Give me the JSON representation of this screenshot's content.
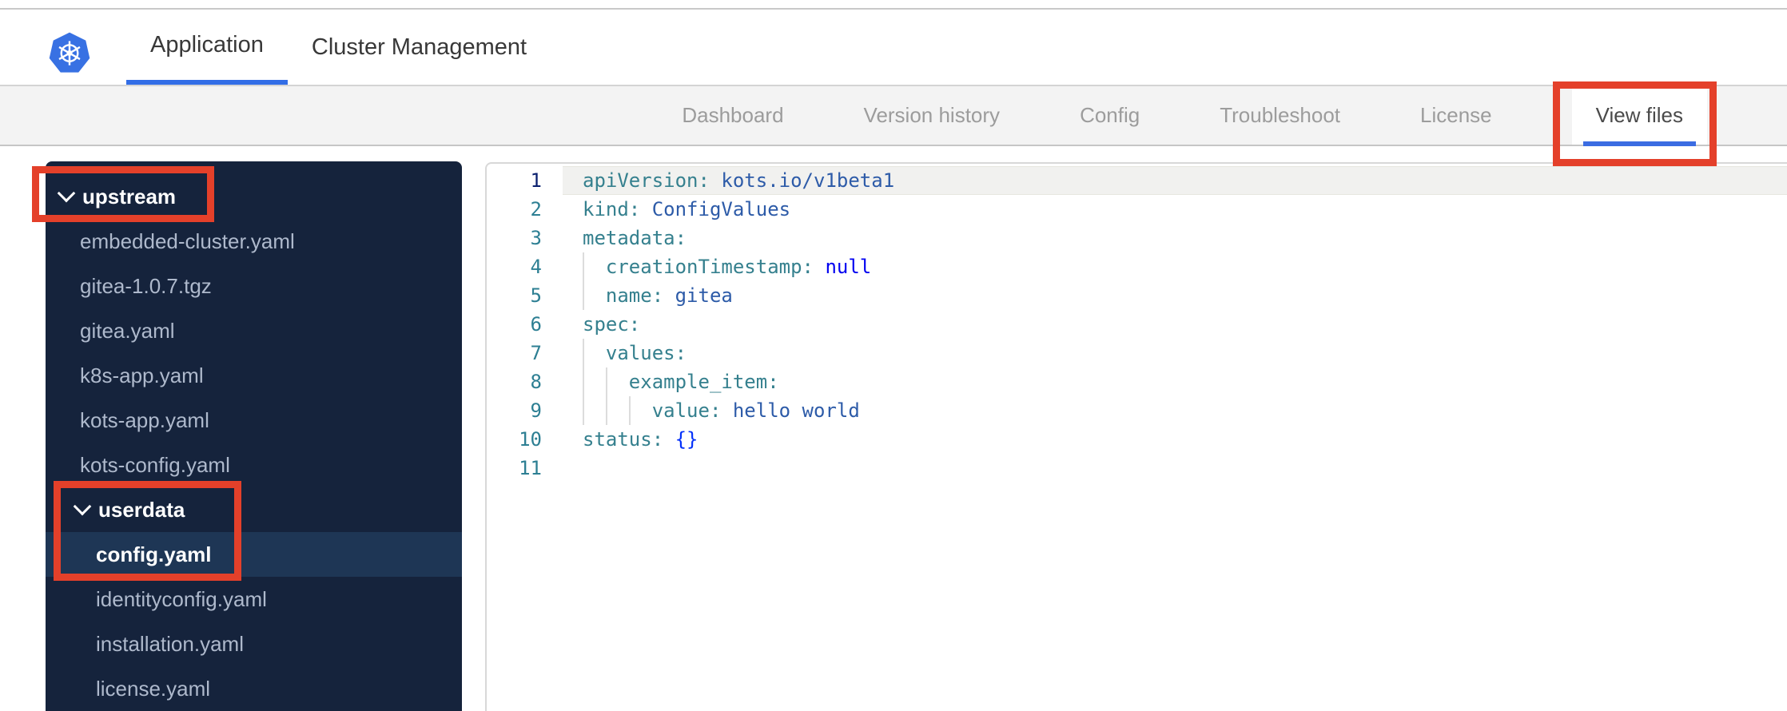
{
  "header": {
    "logo": "kubernetes-logo",
    "tabs": [
      {
        "label": "Application",
        "active": true
      },
      {
        "label": "Cluster Management",
        "active": false
      }
    ]
  },
  "nav": {
    "tabs": [
      {
        "label": "Dashboard",
        "active": false
      },
      {
        "label": "Version history",
        "active": false
      },
      {
        "label": "Config",
        "active": false
      },
      {
        "label": "Troubleshoot",
        "active": false
      },
      {
        "label": "License",
        "active": false
      },
      {
        "label": "View files",
        "active": true,
        "annotated": true
      }
    ]
  },
  "file_tree": {
    "items": [
      {
        "label": "upstream",
        "type": "folder",
        "level": 0,
        "expanded": true,
        "annotated": true
      },
      {
        "label": "embedded-cluster.yaml",
        "type": "file",
        "level": 1
      },
      {
        "label": "gitea-1.0.7.tgz",
        "type": "file",
        "level": 1
      },
      {
        "label": "gitea.yaml",
        "type": "file",
        "level": 1
      },
      {
        "label": "k8s-app.yaml",
        "type": "file",
        "level": 1
      },
      {
        "label": "kots-app.yaml",
        "type": "file",
        "level": 1
      },
      {
        "label": "kots-config.yaml",
        "type": "file",
        "level": 1
      },
      {
        "label": "userdata",
        "type": "folder",
        "level": 1,
        "expanded": true,
        "annotated": true
      },
      {
        "label": "config.yaml",
        "type": "file",
        "level": 2,
        "selected": true,
        "annotated": true
      },
      {
        "label": "identityconfig.yaml",
        "type": "file",
        "level": 2
      },
      {
        "label": "installation.yaml",
        "type": "file",
        "level": 2
      },
      {
        "label": "license.yaml",
        "type": "file",
        "level": 2
      }
    ]
  },
  "editor": {
    "language": "yaml",
    "open_file": "config.yaml",
    "lines": [
      {
        "n": 1,
        "active": true,
        "guides": 0,
        "segments": [
          [
            "key",
            "apiVersion:"
          ],
          [
            "plain",
            " "
          ],
          [
            "val",
            "kots.io/v1beta1"
          ]
        ]
      },
      {
        "n": 2,
        "guides": 0,
        "segments": [
          [
            "key",
            "kind:"
          ],
          [
            "plain",
            " "
          ],
          [
            "val",
            "ConfigValues"
          ]
        ]
      },
      {
        "n": 3,
        "guides": 0,
        "segments": [
          [
            "key",
            "metadata:"
          ]
        ]
      },
      {
        "n": 4,
        "guides": 1,
        "segments": [
          [
            "plain",
            "  "
          ],
          [
            "key",
            "creationTimestamp:"
          ],
          [
            "plain",
            " "
          ],
          [
            "kw",
            "null"
          ]
        ]
      },
      {
        "n": 5,
        "guides": 1,
        "segments": [
          [
            "plain",
            "  "
          ],
          [
            "key",
            "name:"
          ],
          [
            "plain",
            " "
          ],
          [
            "val",
            "gitea"
          ]
        ]
      },
      {
        "n": 6,
        "guides": 0,
        "segments": [
          [
            "key",
            "spec:"
          ]
        ]
      },
      {
        "n": 7,
        "guides": 1,
        "segments": [
          [
            "plain",
            "  "
          ],
          [
            "key",
            "values:"
          ]
        ]
      },
      {
        "n": 8,
        "guides": 2,
        "segments": [
          [
            "plain",
            "    "
          ],
          [
            "key",
            "example_item:"
          ]
        ]
      },
      {
        "n": 9,
        "guides": 3,
        "segments": [
          [
            "plain",
            "      "
          ],
          [
            "key",
            "value:"
          ],
          [
            "plain",
            " "
          ],
          [
            "val",
            "hello world"
          ]
        ]
      },
      {
        "n": 10,
        "guides": 0,
        "segments": [
          [
            "key",
            "status:"
          ],
          [
            "plain",
            " "
          ],
          [
            "br",
            "{}"
          ]
        ]
      },
      {
        "n": 11,
        "guides": 0,
        "segments": []
      }
    ]
  },
  "colors": {
    "accent_blue": "#326de6",
    "annotation_red": "#e4402a",
    "sidebar_bg": "#15233c",
    "sidebar_selected_bg": "#1e3655",
    "nav_bg": "#f3f3f3",
    "code_key": "#35808e",
    "code_value": "#2d5ba8",
    "code_keyword": "#0000f0",
    "code_bracket": "#0431fa",
    "line_number": "#2d7f93",
    "active_line_number": "#0b216f",
    "active_line_bg": "#f1f1ef"
  },
  "annotations": [
    "upstream-folder",
    "userdata-config-file",
    "view-files-tab"
  ]
}
